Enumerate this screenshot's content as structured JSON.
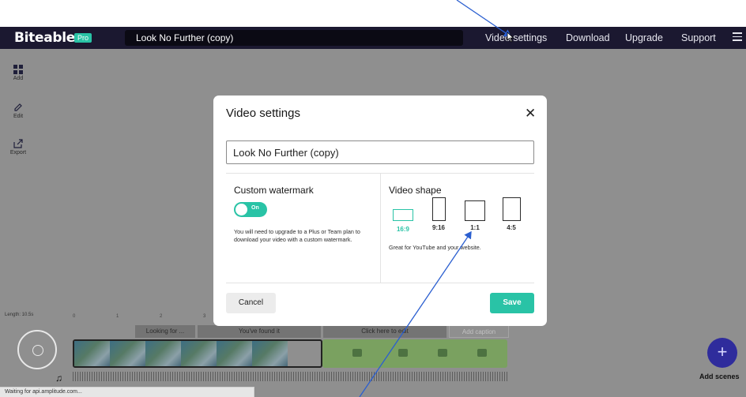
{
  "app": {
    "logo": "Biteable",
    "badge": "Pro",
    "project_title": "Look No Further (copy)"
  },
  "nav": {
    "video_settings": "Video settings",
    "download": "Download",
    "upgrade": "Upgrade",
    "support": "Support",
    "menu_icon": "hamburger-menu-icon"
  },
  "sidebar": {
    "items": [
      {
        "label": "Add",
        "icon": "grid-icon"
      },
      {
        "label": "Edit",
        "icon": "pencil-icon"
      },
      {
        "label": "Export",
        "icon": "export-icon"
      }
    ]
  },
  "timeline": {
    "length": "Length: 10.5s",
    "ticks": [
      "0",
      "1",
      "2",
      "3"
    ],
    "scenes": [
      "Looking for ...",
      "You've found it",
      "Click here to edit"
    ],
    "caption_button": "Add caption",
    "add_scenes": "Add scenes"
  },
  "status_bar": "Waiting for api.amplitude.com...",
  "modal": {
    "title": "Video settings",
    "title_input_value": "Look No Further (copy)",
    "watermark": {
      "heading": "Custom watermark",
      "toggle_label": "On",
      "note": "You will need to upgrade to a Plus or Team plan to download your video with a custom watermark."
    },
    "video_shape": {
      "heading": "Video shape",
      "options": [
        "16:9",
        "9:16",
        "1:1",
        "4:5"
      ],
      "selected": "16:9",
      "note": "Great for YouTube and your website."
    },
    "cancel_label": "Cancel",
    "save_label": "Save"
  },
  "colors": {
    "accent": "#29c3a6",
    "topbar": "#1b1830",
    "add_scenes": "#2f2c9c"
  }
}
